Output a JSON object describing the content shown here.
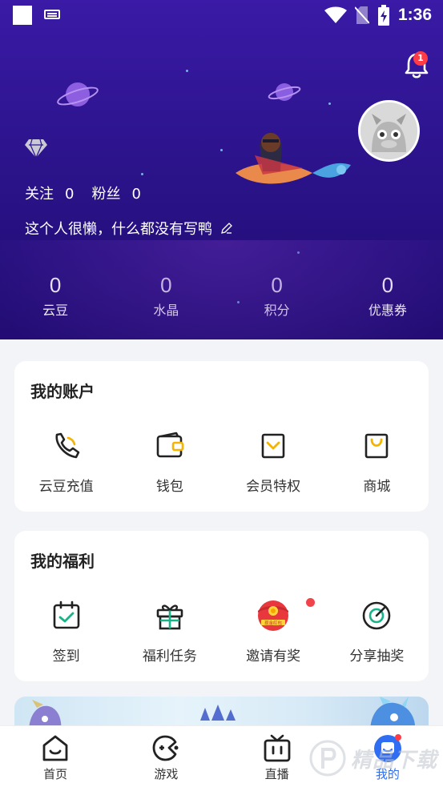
{
  "status_bar": {
    "time": "1:36"
  },
  "notifications": {
    "badge": "1"
  },
  "profile": {
    "follow_label": "关注",
    "follow_count": "0",
    "fans_label": "粉丝",
    "fans_count": "0",
    "bio": "这个人很懒，什么都没有写鸭"
  },
  "stats": [
    {
      "value": "0",
      "label": "云豆"
    },
    {
      "value": "0",
      "label": "水晶"
    },
    {
      "value": "0",
      "label": "积分"
    },
    {
      "value": "0",
      "label": "优惠券"
    }
  ],
  "account": {
    "title": "我的账户",
    "items": [
      {
        "label": "云豆充值",
        "icon": "phone-coin-icon"
      },
      {
        "label": "钱包",
        "icon": "wallet-icon"
      },
      {
        "label": "会员特权",
        "icon": "vip-icon"
      },
      {
        "label": "商城",
        "icon": "shop-bag-icon"
      }
    ]
  },
  "benefits": {
    "title": "我的福利",
    "items": [
      {
        "label": "签到",
        "icon": "calendar-check-icon"
      },
      {
        "label": "福利任务",
        "icon": "gift-icon"
      },
      {
        "label": "邀请有奖",
        "icon": "red-envelope-icon",
        "icon_text": "现金红包"
      },
      {
        "label": "分享抽奖",
        "icon": "lottery-target-icon"
      }
    ]
  },
  "tabbar": {
    "items": [
      {
        "label": "首页",
        "icon": "home-icon"
      },
      {
        "label": "游戏",
        "icon": "gamepad-icon"
      },
      {
        "label": "直播",
        "icon": "tv-icon"
      },
      {
        "label": "我的",
        "icon": "profile-icon"
      }
    ],
    "active": "我的"
  },
  "watermark": {
    "text": "精品下载"
  },
  "colors": {
    "hero": "#2f1592",
    "accent": "#2f6df3",
    "icon_yellow": "#f5b400",
    "badge_red": "#ff3b46"
  }
}
